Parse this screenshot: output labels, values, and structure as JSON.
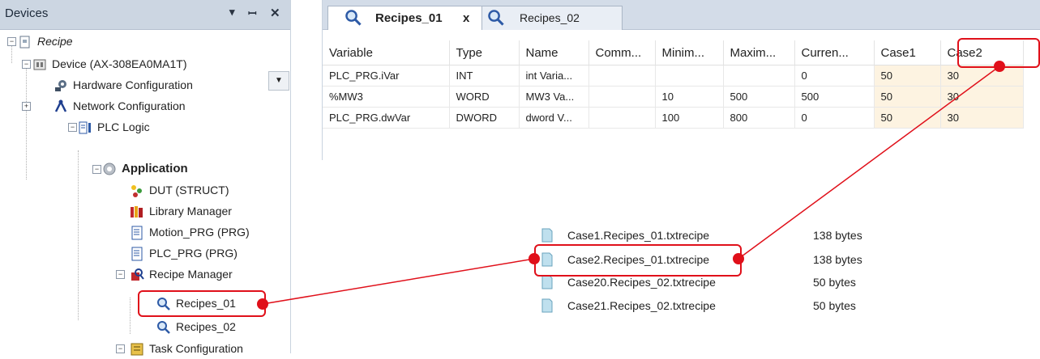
{
  "devices": {
    "title": "Devices",
    "controls": {
      "dropdown": "▾",
      "pin": "Ѩ",
      "close": "✕"
    },
    "tree": [
      {
        "label": "Recipe",
        "italic": true
      },
      {
        "label": "Device (AX-308EA0MA1T)"
      },
      {
        "label": "Hardware Configuration"
      },
      {
        "label": "Network Configuration"
      },
      {
        "label": "PLC Logic"
      },
      {
        "label": "Application",
        "bold": true
      },
      {
        "label": "DUT (STRUCT)"
      },
      {
        "label": "Library Manager"
      },
      {
        "label": "Motion_PRG (PRG)"
      },
      {
        "label": "PLC_PRG (PRG)"
      },
      {
        "label": "Recipe Manager"
      },
      {
        "label": "Recipes_01",
        "highlighted": true
      },
      {
        "label": "Recipes_02"
      },
      {
        "label": "Task Configuration"
      }
    ]
  },
  "editor": {
    "tabs": [
      {
        "label": "Recipes_01",
        "active": true,
        "close": "x"
      },
      {
        "label": "Recipes_02",
        "active": false
      }
    ],
    "columns": [
      "Variable",
      "Type",
      "Name",
      "Comm...",
      "Minim...",
      "Maxim...",
      "Curren...",
      "Case1",
      "Case2"
    ],
    "rows": [
      [
        "PLC_PRG.iVar",
        "INT",
        "int Varia...",
        "",
        "",
        "",
        "0",
        "50",
        "30"
      ],
      [
        "%MW3",
        "WORD",
        "MW3 Va...",
        "",
        "10",
        "500",
        "500",
        "50",
        "30"
      ],
      [
        "PLC_PRG.dwVar",
        "DWORD",
        "dword V...",
        "",
        "100",
        "800",
        "0",
        "50",
        "30"
      ]
    ]
  },
  "files": [
    {
      "name": "Case1.Recipes_01.txtrecipe",
      "size": "138 bytes"
    },
    {
      "name": "Case2.Recipes_01.txtrecipe",
      "size": "138 bytes",
      "highlighted": true
    },
    {
      "name": "Case20.Recipes_02.txtrecipe",
      "size": "50 bytes"
    },
    {
      "name": "Case21.Recipes_02.txtrecipe",
      "size": "50 bytes"
    }
  ],
  "colors": {
    "highlight": "#e0101a",
    "panel_header": "#ccd6e2",
    "case_cell": "#fdf3e1"
  }
}
